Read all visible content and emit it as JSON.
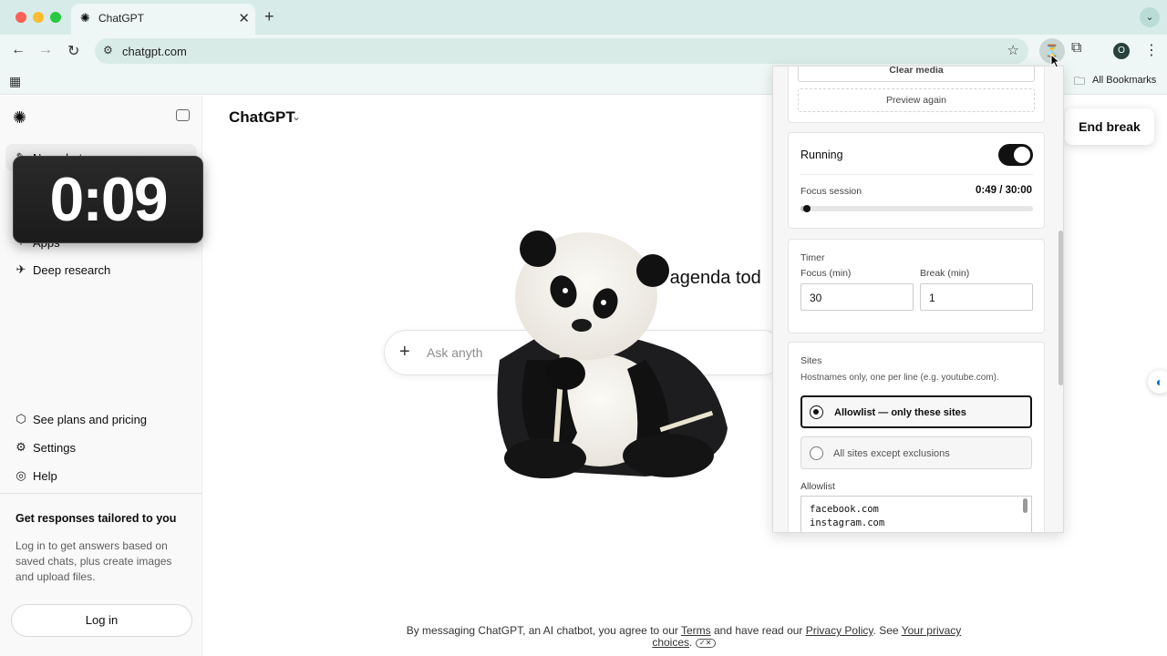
{
  "browser": {
    "tab_title": "ChatGPT",
    "tab_close": "✕",
    "new_tab": "+",
    "tab_menu": "⌄",
    "url": "chatgpt.com",
    "profile_initial": "O",
    "bookmarks_label": "All Bookmarks"
  },
  "sidebar": {
    "items": [
      {
        "label": "New chat",
        "icon": "pencil-icon"
      },
      {
        "label": "Apps",
        "icon": "apps-icon"
      },
      {
        "label": "Deep research",
        "icon": "telescope-icon"
      }
    ],
    "bottom_items": [
      {
        "label": "See plans and pricing",
        "icon": "plans-icon"
      },
      {
        "label": "Settings",
        "icon": "gear-icon"
      },
      {
        "label": "Help",
        "icon": "help-icon"
      }
    ],
    "promo_title": "Get responses tailored to you",
    "promo_body": "Log in to get answers based on saved chats, plus create images and upload files.",
    "login_label": "Log in"
  },
  "timer_overlay": {
    "time": "0:09"
  },
  "main": {
    "model_title": "ChatGPT",
    "headline_fragment": "e agenda tod",
    "composer_placeholder_fragment": "Ask anyth",
    "end_break_label": "End break",
    "footer": {
      "prefix": "By messaging ChatGPT, an AI chatbot, you agree to our ",
      "terms": "Terms",
      "middle": " and have read our ",
      "privacy": "Privacy Policy",
      "see": ". See ",
      "choices": "Your privacy choices",
      "suffix": "."
    }
  },
  "popup": {
    "clear_media": "Clear media",
    "preview_again": "Preview again",
    "running_label": "Running",
    "running_on": true,
    "focus_session_label": "Focus session",
    "focus_session_value": "0:49 / 30:00",
    "focus_progress_fraction": 0.027,
    "timer_label": "Timer",
    "focus_min_label": "Focus (min)",
    "focus_min_value": "30",
    "break_min_label": "Break (min)",
    "break_min_value": "1",
    "sites_label": "Sites",
    "sites_hint": "Hostnames only, one per line (e.g. youtube.com).",
    "allowlist_option": "Allowlist — only these sites",
    "exclusions_option": "All sites except exclusions",
    "allowlist_label": "Allowlist",
    "allowlist_entries": [
      "facebook.com",
      "instagram.com"
    ]
  }
}
